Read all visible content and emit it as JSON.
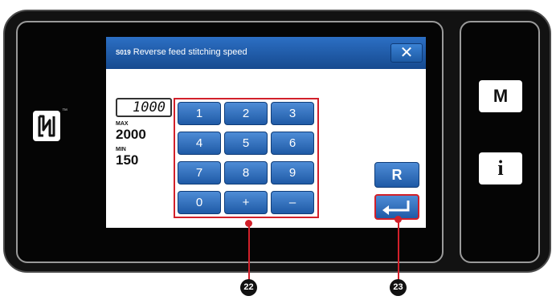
{
  "dialog": {
    "code": "S019",
    "title": "Reverse feed stitching speed",
    "close_label": "✕"
  },
  "entry": {
    "value": "1000",
    "max_label": "MAX",
    "max_value": "2000",
    "min_label": "MIN",
    "min_value": "150"
  },
  "keypad": {
    "keys": [
      "1",
      "2",
      "3",
      "4",
      "5",
      "6",
      "7",
      "8",
      "9",
      "0",
      "+",
      "–"
    ]
  },
  "buttons": {
    "reset_label": "R",
    "enter_icon": "enter-return-icon"
  },
  "side_panel": {
    "menu_label": "M",
    "info_label": "i"
  },
  "logo": {
    "name": "nfc-n-mark-icon",
    "trademark": "™"
  },
  "callouts": {
    "keypad": "22",
    "enter": "23"
  },
  "colors": {
    "accent": "#1f5aa6",
    "highlight": "#d2202a"
  }
}
